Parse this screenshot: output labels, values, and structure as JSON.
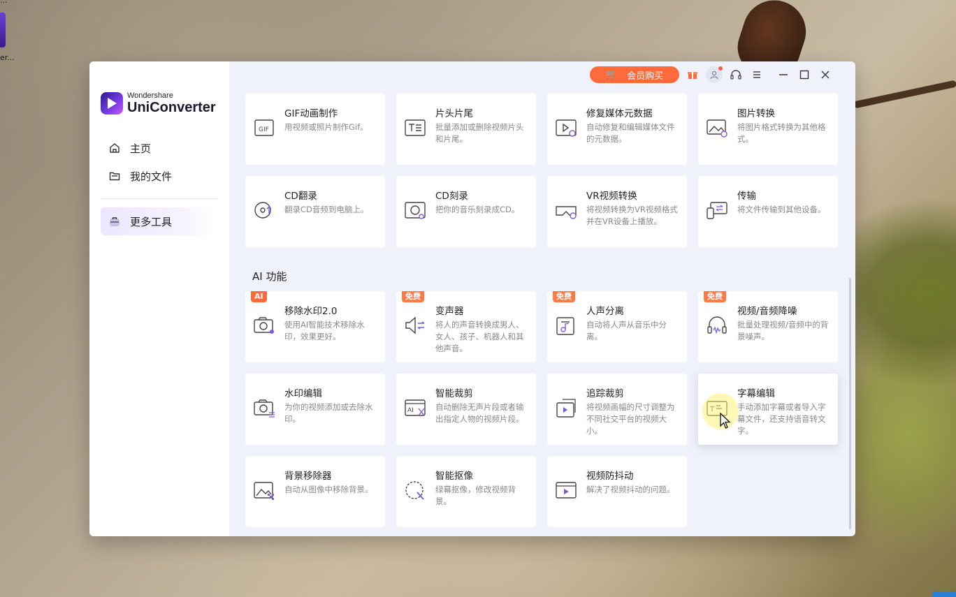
{
  "desktop": {
    "icon_label": "er...",
    "top_label": "..."
  },
  "app": {
    "brand_small": "Wondershare",
    "brand_big": "UniConverter"
  },
  "sidebar": {
    "items": [
      {
        "label": "主页",
        "icon": "home-icon"
      },
      {
        "label": "我的文件",
        "icon": "folder-icon"
      },
      {
        "label": "更多工具",
        "icon": "toolbox-icon",
        "active": true
      }
    ]
  },
  "topbar": {
    "buy_label": "会员购买",
    "icons": [
      "gift-icon",
      "avatar-icon",
      "headset-icon",
      "menu-icon",
      "minimize-icon",
      "maximize-icon",
      "close-icon"
    ]
  },
  "tools": [
    {
      "title": "GIF动画制作",
      "desc": "用视频或照片制作Gif。",
      "icon": "gif-icon"
    },
    {
      "title": "片头片尾",
      "desc": "批量添加或删除视频片头和片尾。",
      "icon": "intro-outro-icon"
    },
    {
      "title": "修复媒体元数据",
      "desc": "自动修复和编辑媒体文件的元数据。",
      "icon": "metadata-icon"
    },
    {
      "title": "图片转换",
      "desc": "将图片格式转换为其他格式。",
      "icon": "image-convert-icon"
    },
    {
      "title": "CD翻录",
      "desc": "翻录CD音频到电脑上。",
      "icon": "cd-rip-icon"
    },
    {
      "title": "CD刻录",
      "desc": "把你的音乐刻录成CD。",
      "icon": "cd-burn-icon"
    },
    {
      "title": "VR视频转换",
      "desc": "将视频转换为VR视频格式并在VR设备上播放。",
      "icon": "vr-icon"
    },
    {
      "title": "传输",
      "desc": "将文件传输到其他设备。",
      "icon": "transfer-icon"
    }
  ],
  "ai_section": {
    "title": "AI 功能",
    "tools": [
      {
        "title": "移除水印2.0",
        "desc": "使用AI智能技术移除水印，效果更好。",
        "icon": "watermark-remove-icon",
        "badge": "AI"
      },
      {
        "title": "变声器",
        "desc": "将人的声音转换成男人、女人、孩子、机器人和其他声音。",
        "icon": "voice-changer-icon",
        "badge": "免费"
      },
      {
        "title": "人声分离",
        "desc": "自动将人声从音乐中分离。",
        "icon": "vocal-remover-icon",
        "badge": "免费"
      },
      {
        "title": "视频/音频降噪",
        "desc": "批量处理视频/音频中的背景噪声。",
        "icon": "noise-reduction-icon",
        "badge": "免费"
      },
      {
        "title": "水印编辑",
        "desc": "为你的视频添加或去除水印。",
        "icon": "watermark-edit-icon"
      },
      {
        "title": "智能裁剪",
        "desc": "自动删除无声片段或者输出指定人物的视频片段。",
        "icon": "smart-trim-icon"
      },
      {
        "title": "追踪裁剪",
        "desc": "将视频画幅的尺寸调整为不同社交平台的视频大小。",
        "icon": "auto-reframe-icon"
      },
      {
        "title": "字幕编辑",
        "desc": "手动添加字幕或者导入字幕文件，还支持语音转文字。",
        "icon": "subtitle-icon"
      },
      {
        "title": "背景移除器",
        "desc": "自动从图像中移除背景。",
        "icon": "bg-remover-icon"
      },
      {
        "title": "智能抠像",
        "desc": "绿幕抠像，修改视频背景。",
        "icon": "smart-cutout-icon"
      },
      {
        "title": "视频防抖动",
        "desc": "解决了视频抖动的问题。",
        "icon": "stabilize-icon"
      }
    ]
  }
}
